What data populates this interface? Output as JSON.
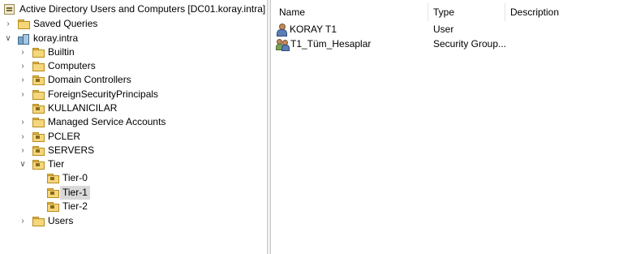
{
  "tree": {
    "root": "Active Directory Users and Computers [DC01.koray.intra]",
    "saved_queries": "Saved Queries",
    "domain": "koray.intra",
    "builtin": "Builtin",
    "computers": "Computers",
    "domain_controllers": "Domain Controllers",
    "foreign": "ForeignSecurityPrincipals",
    "kullanicilar": "KULLANICILAR",
    "msa": "Managed Service Accounts",
    "pcler": "PCLER",
    "servers": "SERVERS",
    "tier": "Tier",
    "tier0": "Tier-0",
    "tier1": "Tier-1",
    "tier2": "Tier-2",
    "users": "Users"
  },
  "list": {
    "columns": {
      "name": "Name",
      "type": "Type",
      "description": "Description"
    },
    "rows": [
      {
        "name": "KORAY T1",
        "type": "User",
        "icon": "user-icon"
      },
      {
        "name": "T1_Tüm_Hesaplar",
        "type": "Security Group...",
        "icon": "group-icon"
      }
    ]
  },
  "icons": {
    "expand": "chevron-right",
    "collapse": "chevron-down"
  }
}
